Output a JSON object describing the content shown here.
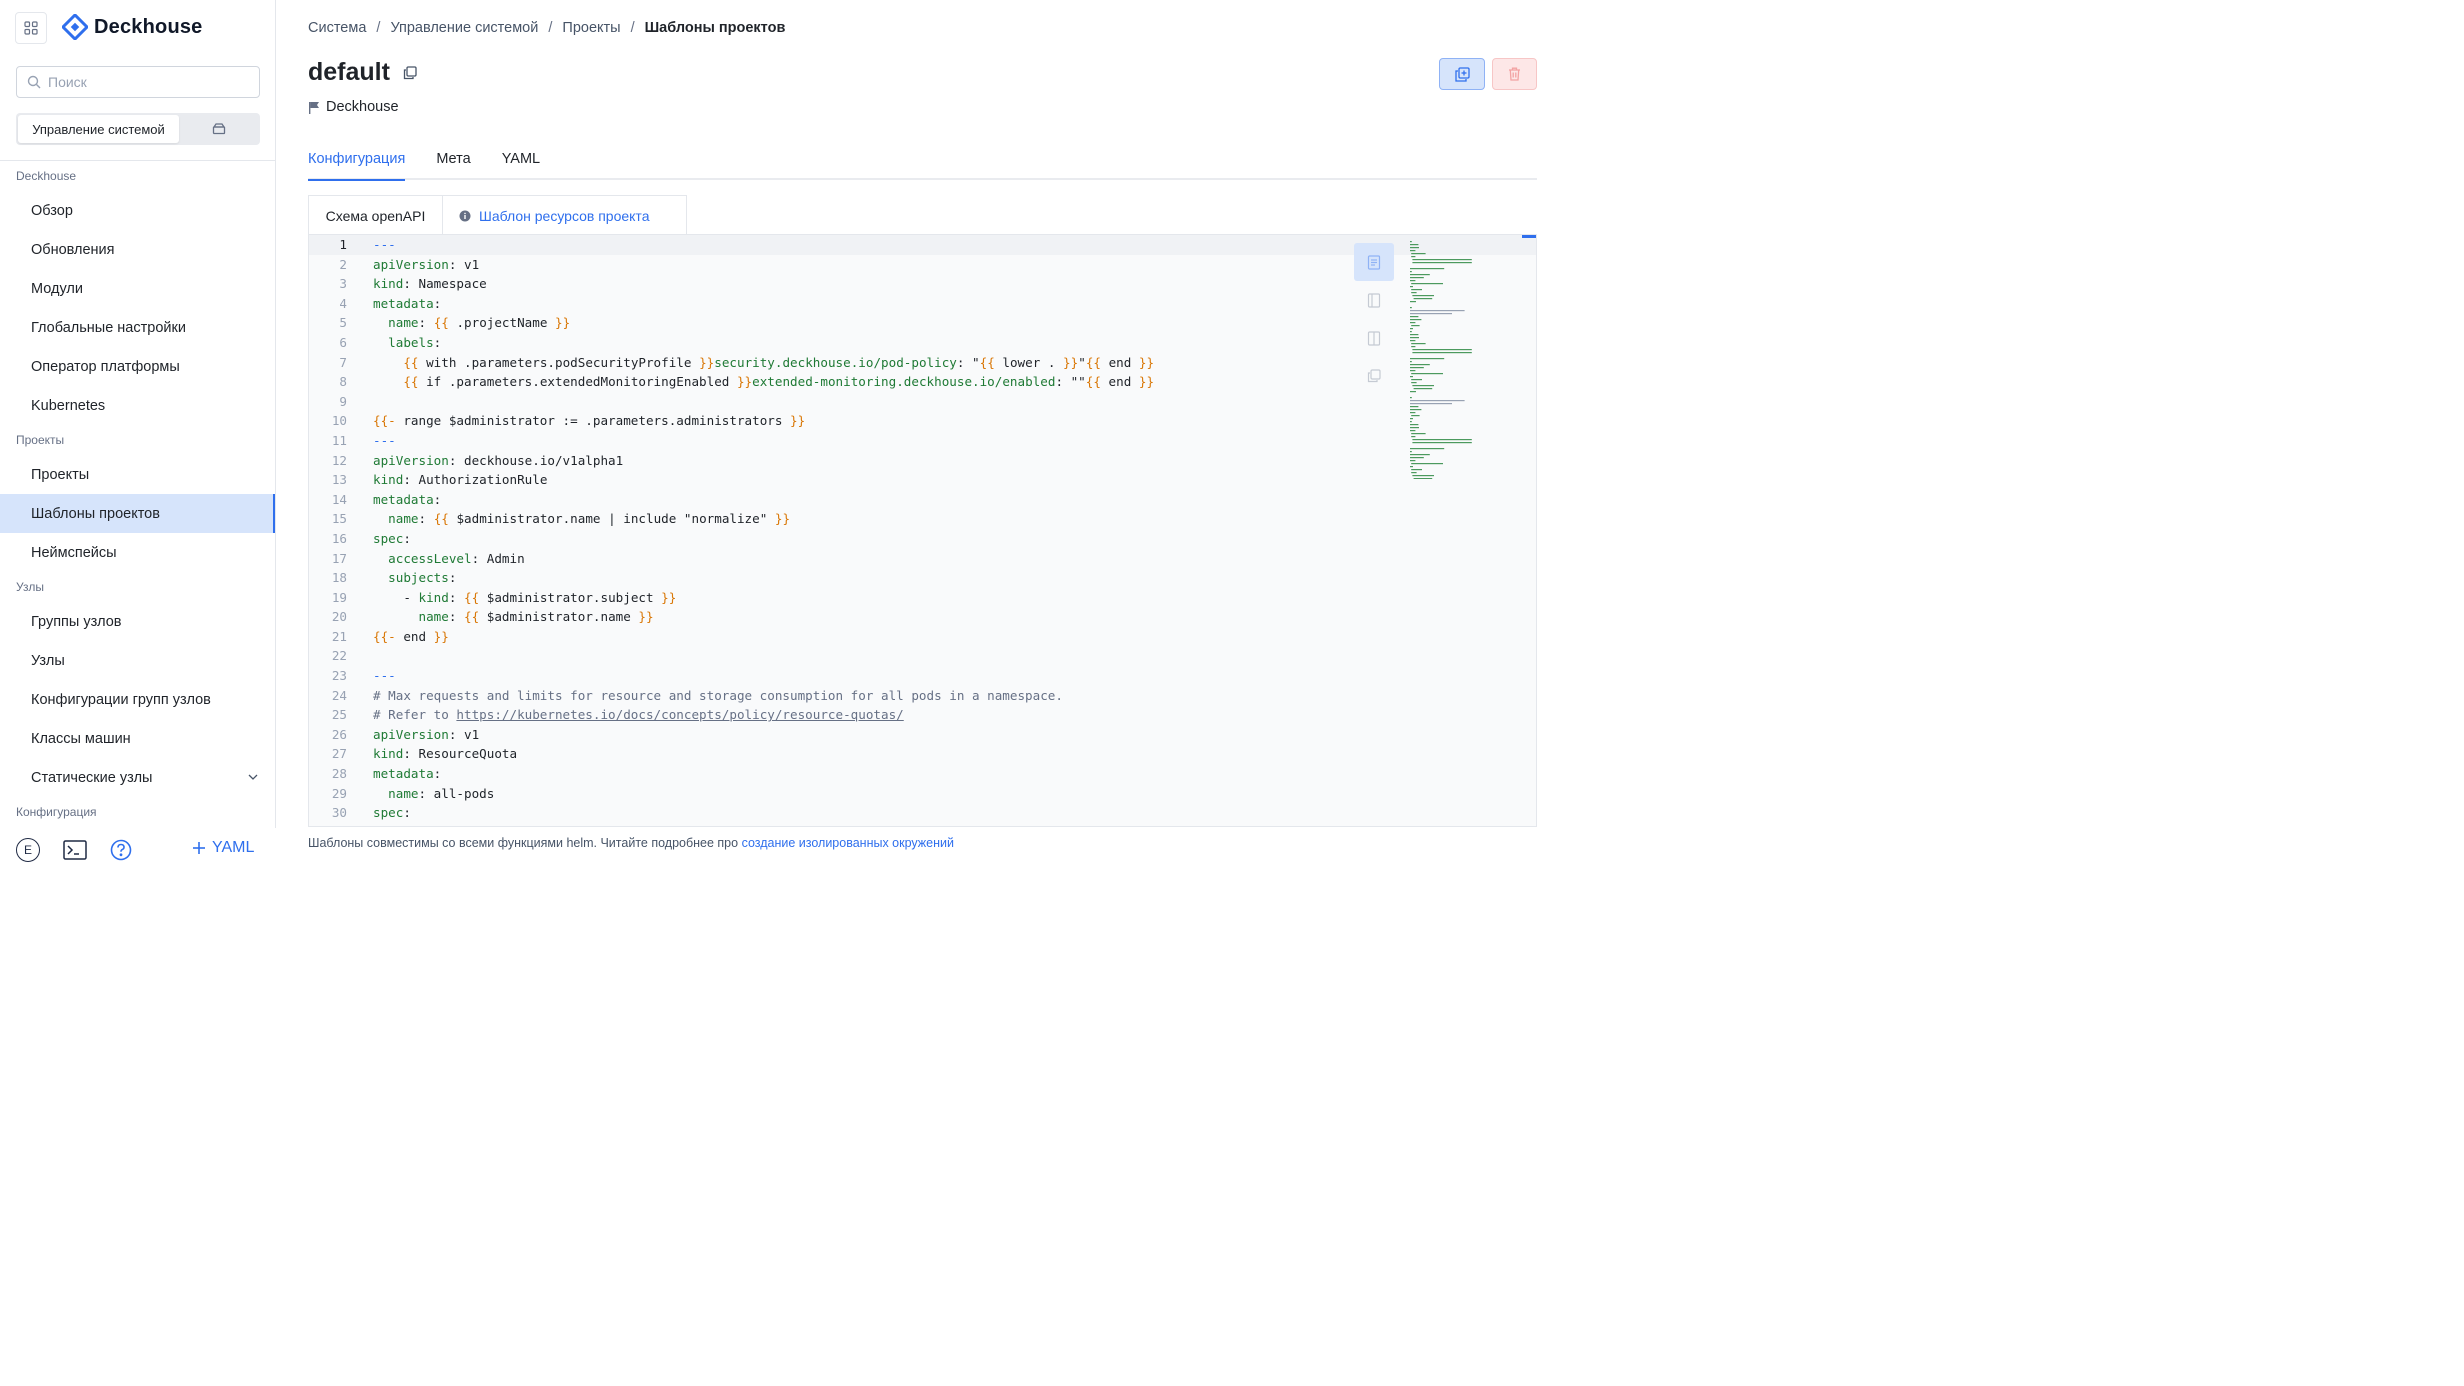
{
  "app": {
    "name": "Deckhouse"
  },
  "search": {
    "placeholder": "Поиск"
  },
  "switcher": {
    "active": "Управление системой"
  },
  "nav": {
    "groups": [
      {
        "label": "Deckhouse",
        "items": [
          "Обзор",
          "Обновления",
          "Модули",
          "Глобальные настройки",
          "Оператор платформы",
          "Kubernetes"
        ]
      },
      {
        "label": "Проекты",
        "items": [
          "Проекты",
          "Шаблоны проектов",
          "Неймспейсы"
        ]
      },
      {
        "label": "Узлы",
        "items": [
          "Группы узлов",
          "Узлы",
          "Конфигурации групп узлов",
          "Классы машин",
          "Статические узлы"
        ]
      },
      {
        "label": "Конфигурация",
        "items": []
      }
    ],
    "active_item": "Шаблоны проектов"
  },
  "bottom": {
    "avatar_letter": "E",
    "yaml_label": "YAML"
  },
  "breadcrumb": [
    "Система",
    "Управление системой",
    "Проекты",
    "Шаблоны проектов"
  ],
  "page": {
    "title": "default",
    "owner": "Deckhouse"
  },
  "tabs": [
    "Конфигурация",
    "Мета",
    "YAML"
  ],
  "active_tab": "Конфигурация",
  "subtabs": [
    "Схема openAPI",
    "Шаблон ресурсов проекта"
  ],
  "editor": {
    "line_numbers": [
      "1",
      "2",
      "3",
      "4",
      "5",
      "6",
      "7",
      "8",
      "9",
      "10",
      "11",
      "12",
      "13",
      "14",
      "15",
      "16",
      "17",
      "18",
      "19",
      "20",
      "21",
      "22",
      "23",
      "24",
      "25",
      "26",
      "27",
      "28",
      "29",
      "30"
    ],
    "lines": [
      "---",
      "apiVersion: v1",
      "kind: Namespace",
      "metadata:",
      "  name: {{ .projectName }}",
      "  labels:",
      "    {{ with .parameters.podSecurityProfile }}security.deckhouse.io/pod-policy: \"{{ lower . }}\"{{ end }}",
      "    {{ if .parameters.extendedMonitoringEnabled }}extended-monitoring.deckhouse.io/enabled: \"\"{{ end }}",
      "",
      "{{- range $administrator := .parameters.administrators }}",
      "---",
      "apiVersion: deckhouse.io/v1alpha1",
      "kind: AuthorizationRule",
      "metadata:",
      "  name: {{ $administrator.name | include \"normalize\" }}",
      "spec:",
      "  accessLevel: Admin",
      "  subjects:",
      "    - kind: {{ $administrator.subject }}",
      "      name: {{ $administrator.name }}",
      "{{- end }}",
      "",
      "---",
      "# Max requests and limits for resource and storage consumption for all pods in a namespace.",
      "# Refer to https://kubernetes.io/docs/concepts/policy/resource-quotas/",
      "apiVersion: v1",
      "kind: ResourceQuota",
      "metadata:",
      "  name: all-pods",
      "spec:"
    ]
  },
  "footnote": {
    "text": "Шаблоны совместимы со всеми функциями helm. Читайте подробнее про",
    "link": "создание изолированных окружений"
  },
  "colors": {
    "accent": "#2f6fed",
    "key": "#1f7a35",
    "brace": "#d97706",
    "active_bg": "#d6e4fb"
  }
}
